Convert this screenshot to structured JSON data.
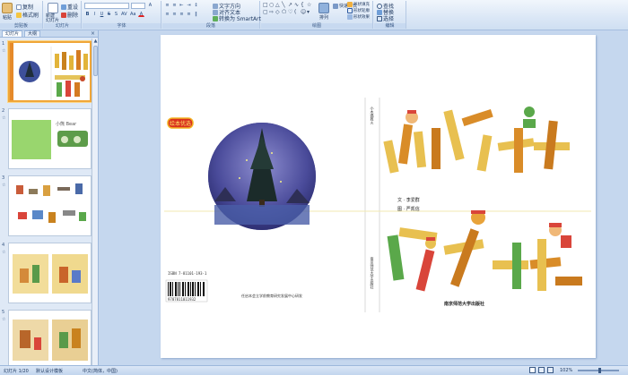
{
  "ribbon": {
    "clipboard": {
      "paste": "粘贴",
      "copy": "复制",
      "format_painter": "格式刷",
      "group": "剪贴板"
    },
    "slides": {
      "new_slide": "新建\n幻灯片",
      "reset": "重设",
      "delete": "删除",
      "group": "幻灯片"
    },
    "font": {
      "group": "字体"
    },
    "paragraph": {
      "text_direction": "文字方向",
      "align_text": "对齐文本",
      "convert_smartart": "转换为 SmartArt",
      "group": "段落"
    },
    "drawing": {
      "arrange": "排列",
      "quick_styles": "快速样式",
      "shape_fill": "形状填充",
      "shape_outline": "形状轮廓",
      "shape_effects": "形状效果",
      "group": "绘图"
    },
    "editing": {
      "find": "查找",
      "replace": "替换",
      "select": "选择",
      "group": "编辑"
    }
  },
  "left_pane": {
    "tabs": [
      "幻灯片",
      "大纲"
    ],
    "close": "×",
    "thumbnails": [
      {
        "num": "1",
        "selected": true
      },
      {
        "num": "2",
        "selected": false,
        "title": "小熊 Bear"
      },
      {
        "num": "3",
        "selected": false
      },
      {
        "num": "4",
        "selected": false
      },
      {
        "num": "5",
        "selected": false
      }
    ]
  },
  "slide": {
    "badge": "绘本优选",
    "title": "小木偶",
    "title2": "救火",
    "credit1": "文 · 李爱群",
    "credit2": "图 · 严凯信",
    "publisher": "南京师范大学出版社",
    "spine": "南京师范大学出版社",
    "spine_top": "小木偶救火",
    "isbn": "ISBN 7-81101-193-1",
    "isbn_digits": "9787811011932",
    "back_note": "任启本会立学前教育研究发展中心研发"
  },
  "status": {
    "slide_info": "幻灯片 1/20",
    "theme": "默认设计模板",
    "language": "中文(简体，中国)",
    "zoom": "102%"
  },
  "colors": {
    "accent_orange": "#f0a638",
    "ribbon_bg": "#dbe7f6",
    "workspace": "#c5d7ee"
  }
}
